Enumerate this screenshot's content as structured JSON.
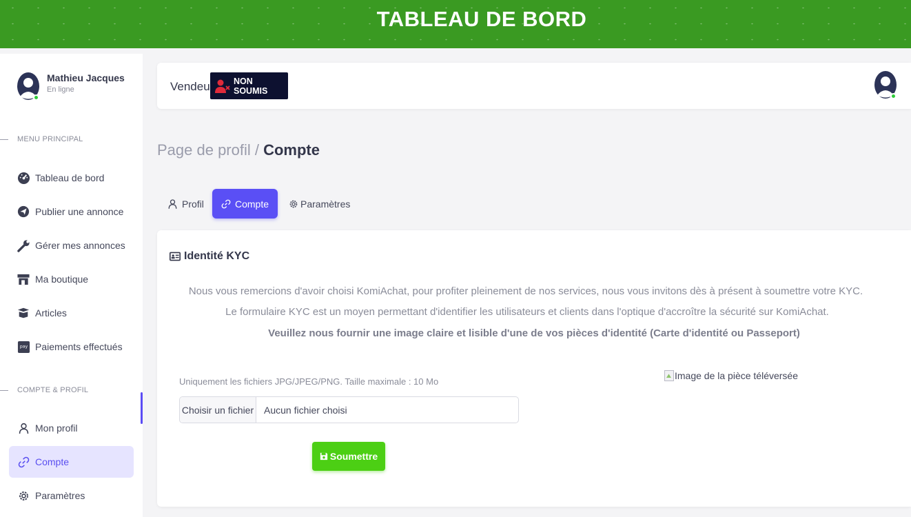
{
  "topbar": {
    "title": "TABLEAU DE BORD"
  },
  "user": {
    "name": "Mathieu Jacques",
    "status": "En ligne"
  },
  "sidebar": {
    "main_section": "MENU PRINCIPAL",
    "main_items": [
      {
        "label": "Tableau de bord",
        "icon": "dashboard-icon"
      },
      {
        "label": "Publier une annonce",
        "icon": "send-icon"
      },
      {
        "label": "Gérer mes annonces",
        "icon": "wrench-icon"
      },
      {
        "label": "Ma boutique",
        "icon": "store-icon"
      },
      {
        "label": "Articles",
        "icon": "box-icon"
      },
      {
        "label": "Paiements effectués",
        "icon": "pay-icon"
      }
    ],
    "account_section": "COMPTE & PROFIL",
    "account_items": [
      {
        "label": "Mon profil",
        "icon": "user-icon"
      },
      {
        "label": "Compte",
        "icon": "link-icon",
        "active": true
      },
      {
        "label": "Paramètres",
        "icon": "gear-icon"
      }
    ]
  },
  "header": {
    "role_label": "Vendeur",
    "status_badge": "NON SOUMIS"
  },
  "breadcrumb": {
    "parent": "Page de profil",
    "separator": " / ",
    "current": "Compte"
  },
  "tabs": [
    {
      "label": "Profil",
      "icon": "user-icon"
    },
    {
      "label": "Compte",
      "icon": "link-icon",
      "active": true
    },
    {
      "label": "Paramètres",
      "icon": "gear-icon"
    }
  ],
  "kyc": {
    "title": "Identité KYC",
    "line1": "Nous vous remercions d'avoir choisi KomiAchat, pour profiter pleinement de nos services, nous vous invitons dès à présent à soumettre votre KYC.",
    "line2": "Le formulaire KYC est un moyen permettant d'identifier les utilisateurs et clients dans l'optique d'accroître la sécurité sur KomiAchat.",
    "line3": "Veuillez nous fournir une image claire et lisible d'une de vos pièces d'identité (Carte d'identité ou Passeport)",
    "file_hint": "Uniquement les fichiers JPG/JPEG/PNG. Taille maximale : 10 Mo",
    "file_button": "Choisir un fichier",
    "file_name": "Aucun fichier choisi",
    "preview_alt": "Image de la pièce téléversée",
    "submit": "Soumettre"
  },
  "colors": {
    "brand_green": "#3a9a22",
    "accent": "#5a4ff5",
    "submit_green": "#4ccf14",
    "badge_dark": "#0d1130"
  }
}
